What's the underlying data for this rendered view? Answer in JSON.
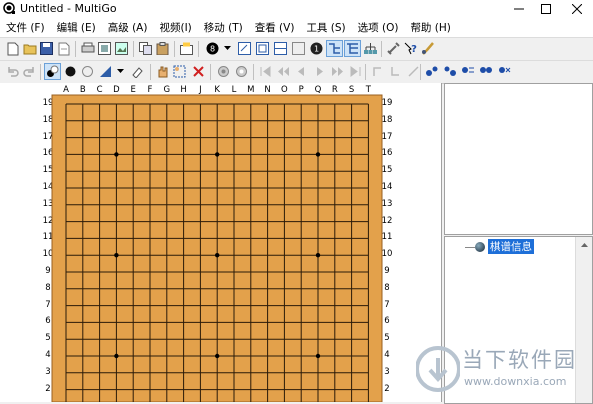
{
  "window": {
    "title": "Untitled - MultiGo"
  },
  "menu": [
    "文件 (F)",
    "编辑 (E)",
    "高级 (A)",
    "视频(I)",
    "移动 (T)",
    "查看 (V)",
    "工具 (S)",
    "选项 (O)",
    "帮助 (H)"
  ],
  "board": {
    "columns": [
      "A",
      "B",
      "C",
      "D",
      "E",
      "F",
      "G",
      "H",
      "J",
      "K",
      "L",
      "M",
      "N",
      "O",
      "P",
      "Q",
      "R",
      "S",
      "T"
    ],
    "rows_visible": [
      "19",
      "18",
      "17",
      "16",
      "15",
      "14",
      "13",
      "12",
      "11",
      "10",
      "9",
      "8",
      "7",
      "6",
      "5",
      "4",
      "3",
      "2"
    ]
  },
  "tree": {
    "root_label": "棋谱信息"
  },
  "watermark": {
    "name": "当下软件园",
    "url": "www.downxia.com"
  },
  "colors": {
    "board": "#e3a14b",
    "grid": "#2a1a08",
    "selection": "#1e6fd8"
  }
}
